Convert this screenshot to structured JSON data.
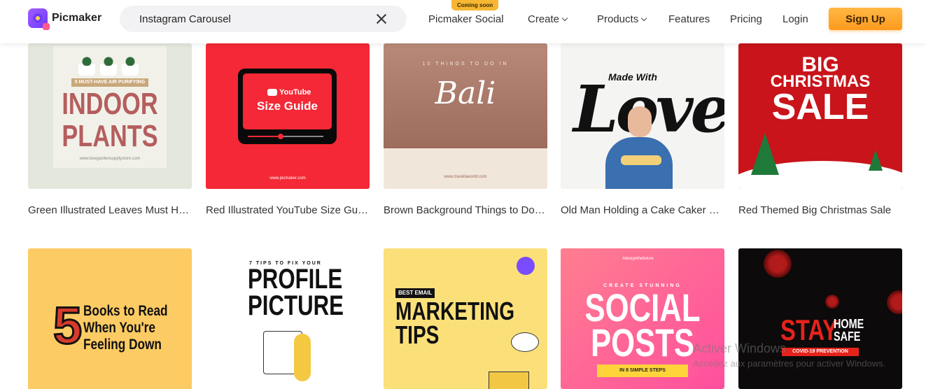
{
  "header": {
    "logo_text": "Picmaker",
    "search": {
      "value": "Instagram Carousel",
      "placeholder": ""
    },
    "nav": {
      "social": "Picmaker Social",
      "social_badge": "Coming soon",
      "create": "Create",
      "products": "Products",
      "features": "Features",
      "pricing": "Pricing",
      "login": "Login",
      "signup": "Sign Up"
    }
  },
  "templates": [
    {
      "title": "Green Illustrated Leaves Must Have Air Purifying Indoor Plants",
      "thumb": {
        "tag": "5 MUST-HAVE AIR PURIFYING",
        "line1": "INDOOR",
        "line2": "PLANTS",
        "url": "www.beegardensupplystore.com"
      }
    },
    {
      "title": "Red Illustrated YouTube Size Guide",
      "thumb": {
        "brand": "YouTube",
        "line1": "Size Guide",
        "url": "www.picmaker.com"
      }
    },
    {
      "title": "Brown Background Things to Do in Bali",
      "thumb": {
        "tag": "10 THINGS TO DO IN",
        "line1": "Bali",
        "url": "www.travellaworld.com"
      }
    },
    {
      "title": "Old Man Holding a Cake Caker Made With Love",
      "thumb": {
        "tag": "Made With",
        "line1": "Love"
      }
    },
    {
      "title": "Red Themed Big Christmas Sale",
      "thumb": {
        "line1": "BIG",
        "line2": "CHRISTMAS",
        "line3": "SALE"
      }
    },
    {
      "title": "",
      "thumb": {
        "num": "5",
        "line1": "Books to Read",
        "line2": "When You're",
        "line3": "Feeling Down"
      }
    },
    {
      "title": "",
      "thumb": {
        "tag": "7 TIPS TO FIX YOUR",
        "line1": "PROFILE",
        "line2": "PICTURE"
      }
    },
    {
      "title": "",
      "thumb": {
        "tag": "BEST EMAIL",
        "line1": "MARKETING",
        "line2": "TIPS"
      }
    },
    {
      "title": "",
      "thumb": {
        "hash": "#designthefuture",
        "tag": "CREATE STUNNING",
        "line1": "SOCIAL",
        "line2": "POSTS",
        "foot": "IN 8 SIMPLE STEPS"
      }
    },
    {
      "title": "",
      "thumb": {
        "line1": "STAY",
        "line2": "HOME",
        "line3": "SAFE",
        "foot": "COVID-19 PREVENTION"
      }
    }
  ],
  "watermark": {
    "line1": "Activer Windows",
    "line2": "Accédez aux paramètres pour activer Windows."
  },
  "colors": {
    "accent": "#ff9a1e",
    "brand": "#6d3bff"
  }
}
